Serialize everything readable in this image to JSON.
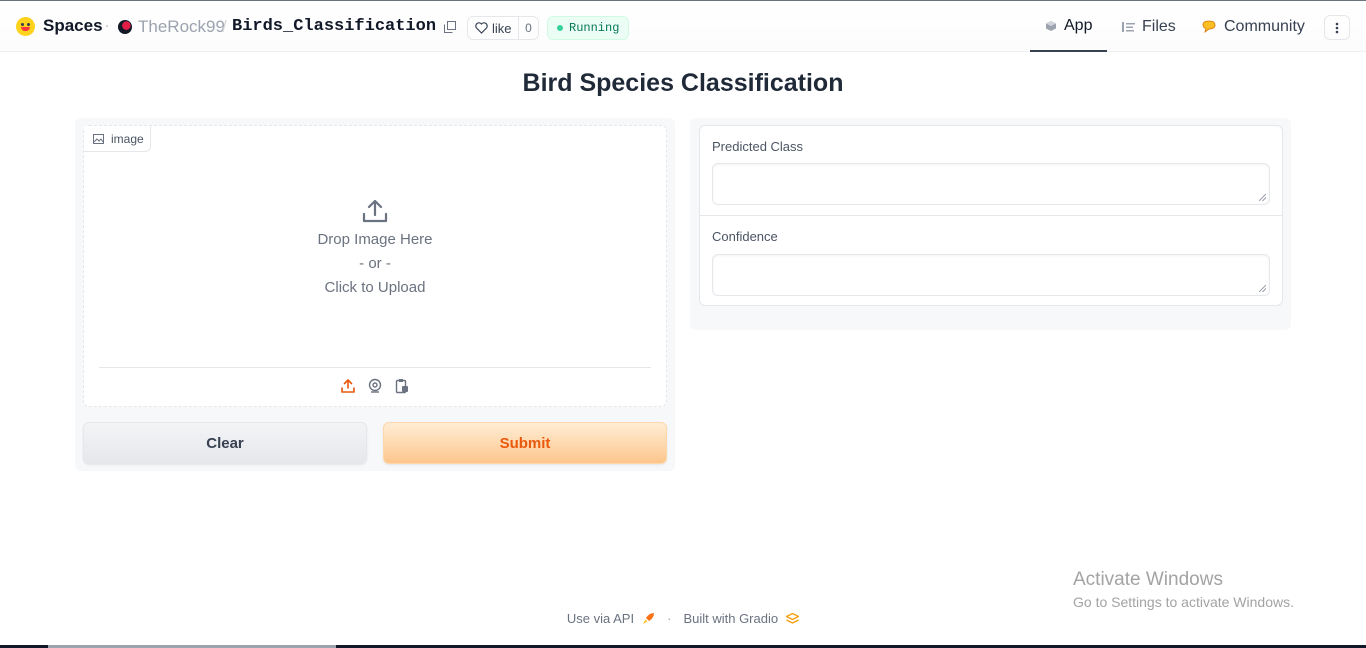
{
  "header": {
    "brand": "Spaces",
    "owner": "TheRock99",
    "separator": "/",
    "repo": "Birds_Classification",
    "like_label": "like",
    "like_count": "0",
    "status": "Running",
    "nav": {
      "app": "App",
      "files": "Files",
      "community": "Community"
    }
  },
  "app": {
    "title": "Bird Species Classification",
    "input": {
      "label": "image",
      "drop_text": "Drop Image Here",
      "or_text": "- or -",
      "click_text": "Click to Upload"
    },
    "buttons": {
      "clear": "Clear",
      "submit": "Submit"
    },
    "outputs": [
      {
        "label": "Predicted Class",
        "value": ""
      },
      {
        "label": "Confidence",
        "value": ""
      }
    ]
  },
  "footer": {
    "api": "Use via API",
    "separator": "·",
    "built": "Built with Gradio"
  },
  "watermark": {
    "title": "Activate Windows",
    "subtitle": "Go to Settings to activate Windows."
  },
  "colors": {
    "accent": "#ea580c",
    "status": "#047857",
    "brand_yellow": "#ffd21e"
  }
}
